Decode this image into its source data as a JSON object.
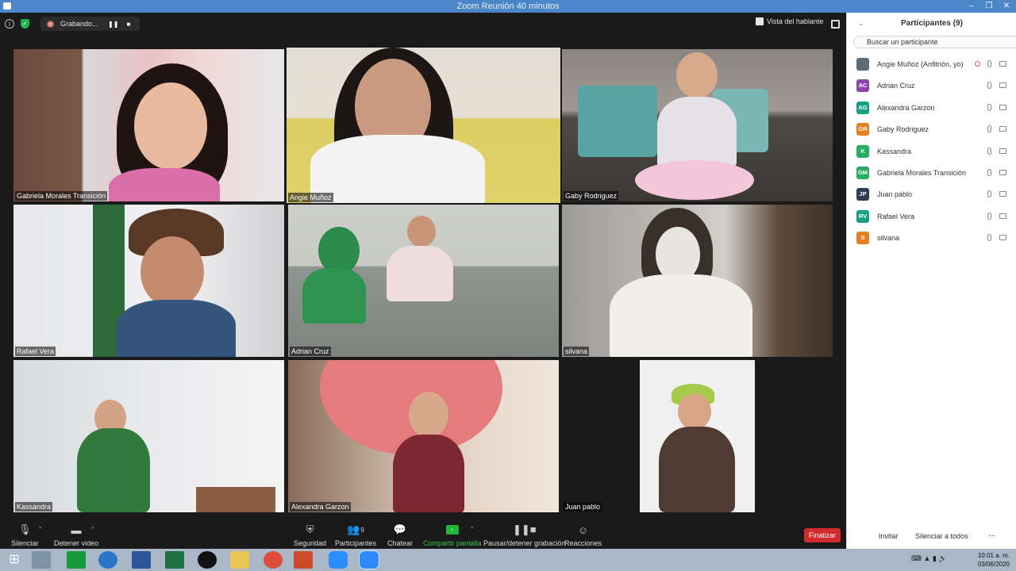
{
  "window": {
    "title": "Zoom Reunión 40 minutos"
  },
  "topbar": {
    "recording_label": "Grabando...",
    "speaker_view_label": "Vista del hablante"
  },
  "tiles": [
    {
      "name": "Gabriela Morales Transición",
      "active": false
    },
    {
      "name": "Angie Muñoz",
      "active": true
    },
    {
      "name": "Gaby Rodriguez",
      "active": false
    },
    {
      "name": "Rafael Vera",
      "active": false
    },
    {
      "name": "Adrian Cruz",
      "active": false
    },
    {
      "name": "silvana",
      "active": false
    },
    {
      "name": "Kassandra",
      "active": false
    },
    {
      "name": "Alexandra Garzon",
      "active": false
    },
    {
      "name": "Juan pablo",
      "active": false
    }
  ],
  "toolbar": {
    "mute_label": "Silenciar",
    "stop_video_label": "Detener video",
    "security_label": "Seguridad",
    "participants_label": "Participantes",
    "participants_count": "9",
    "chat_label": "Chatear",
    "share_label": "Compartir pantalla",
    "pause_recording_label": "Pausar/detener grabación",
    "reactions_label": "Reacciones",
    "end_label": "Finalizar"
  },
  "panel": {
    "title": "Participantes (9)",
    "search_placeholder": "Buscar un participante",
    "participants": [
      {
        "initials": "",
        "name": "Angie Muñoz (Anfitrión, yo)",
        "color": "#5b6b7a",
        "recording": true
      },
      {
        "initials": "AC",
        "name": "Adrian Cruz",
        "color": "#8e44ad"
      },
      {
        "initials": "AG",
        "name": "Alexandra Garzon",
        "color": "#16a085"
      },
      {
        "initials": "GR",
        "name": "Gaby Rodriguez",
        "color": "#e67e22"
      },
      {
        "initials": "K",
        "name": "Kassandra",
        "color": "#27ae60"
      },
      {
        "initials": "GM",
        "name": "Gabriela Morales Transición",
        "color": "#27ae60"
      },
      {
        "initials": "JP",
        "name": "Juan pablo",
        "color": "#2c3e50"
      },
      {
        "initials": "RV",
        "name": "Rafael Vera",
        "color": "#16a085"
      },
      {
        "initials": "S",
        "name": "silvana",
        "color": "#e67e22"
      }
    ],
    "invite_label": "Invitar",
    "mute_all_label": "Silenciar a todos",
    "more_label": "..."
  },
  "taskbar": {
    "time": "10:01 a. m.",
    "date": "03/06/2020"
  }
}
